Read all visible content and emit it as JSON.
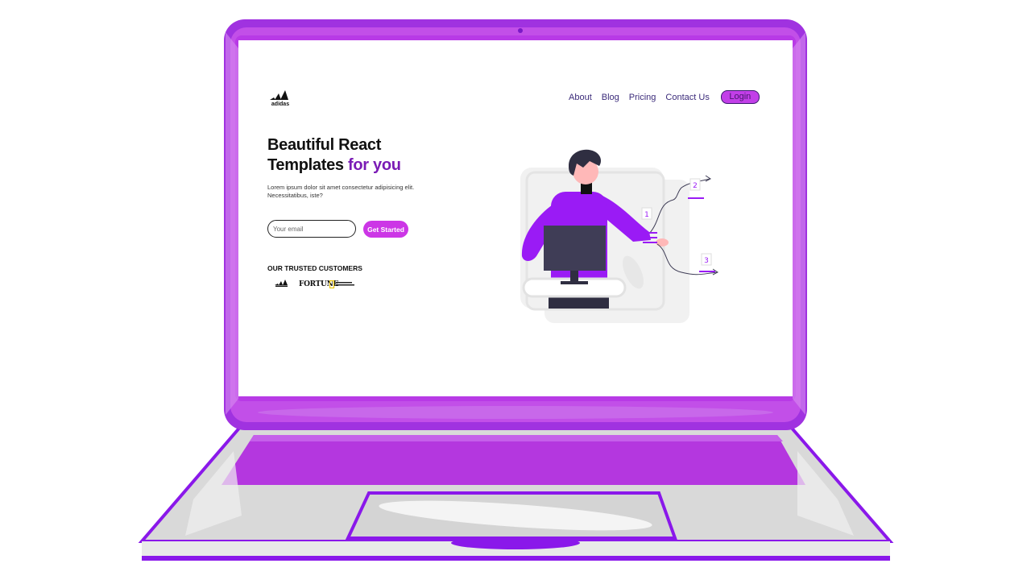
{
  "colors": {
    "brand": "#cc36e6",
    "device": "#a032e0",
    "accent_text": "#7a1bb5",
    "nav_text": "#3b2b7a"
  },
  "header": {
    "logo_icon": "adidas-logo",
    "nav": [
      {
        "label": "About"
      },
      {
        "label": "Blog"
      },
      {
        "label": "Pricing"
      },
      {
        "label": "Contact Us"
      }
    ],
    "login_label": "Login"
  },
  "hero": {
    "title_line1": "Beautiful React",
    "title_line2": "Templates",
    "title_accent": "for you",
    "description": "Lorem ipsum dolor sit amet consectetur adipisicing elit. Necessitatibus, iste?",
    "email_placeholder": "Your email",
    "cta_label": "Get Started"
  },
  "customers": {
    "heading": "OUR TRUSTED CUSTOMERS",
    "logos": [
      "adidas-logo",
      "fortune-logo",
      "national-geographic-logo"
    ],
    "fortune_text": "FORTUNE"
  },
  "illustration": {
    "labels": [
      "1",
      "2",
      "3"
    ]
  }
}
